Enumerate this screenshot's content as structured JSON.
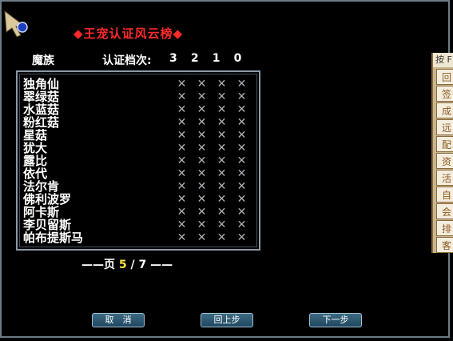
{
  "title": "◆王宠认证风云榜◆",
  "header": {
    "race": "魔族",
    "level_label": "认证档次:",
    "grades": [
      "3",
      "2",
      "1",
      "0"
    ]
  },
  "list": [
    {
      "name": "独角仙",
      "marks": [
        "✕",
        "✕",
        "✕",
        "✕"
      ]
    },
    {
      "name": "翠绿菇",
      "marks": [
        "✕",
        "✕",
        "✕",
        "✕"
      ]
    },
    {
      "name": "水蓝菇",
      "marks": [
        "✕",
        "✕",
        "✕",
        "✕"
      ]
    },
    {
      "name": "粉红菇",
      "marks": [
        "✕",
        "✕",
        "✕",
        "✕"
      ]
    },
    {
      "name": "星菇",
      "marks": [
        "✕",
        "✕",
        "✕",
        "✕"
      ]
    },
    {
      "name": "犹大",
      "marks": [
        "✕",
        "✕",
        "✕",
        "✕"
      ]
    },
    {
      "name": "露比",
      "marks": [
        "✕",
        "✕",
        "✕",
        "✕"
      ]
    },
    {
      "name": "依代",
      "marks": [
        "✕",
        "✕",
        "✕",
        "✕"
      ]
    },
    {
      "name": "法尔肯",
      "marks": [
        "✕",
        "✕",
        "✕",
        "✕"
      ]
    },
    {
      "name": "佛利波罗",
      "marks": [
        "✕",
        "✕",
        "✕",
        "✕"
      ]
    },
    {
      "name": "阿卡斯",
      "marks": [
        "✕",
        "✕",
        "✕",
        "✕"
      ]
    },
    {
      "name": "李贝留斯",
      "marks": [
        "✕",
        "✕",
        "✕",
        "✕"
      ]
    },
    {
      "name": "帕布提斯马",
      "marks": [
        "✕",
        "✕",
        "✕",
        "✕"
      ]
    }
  ],
  "pager": {
    "prefix": "——页",
    "current": "5",
    "sep": "/",
    "total": "7",
    "suffix": "——"
  },
  "buttons": {
    "cancel": "取　消",
    "prev": "回上步",
    "next": "下一步"
  },
  "side_panel": {
    "top": "按 F",
    "tabs": [
      "回",
      "签",
      "成",
      "远",
      "配",
      "资",
      "活",
      "自",
      "会",
      "排",
      "客"
    ]
  },
  "colors": {
    "title": "#ff2a2a",
    "current_page": "#ffe34a",
    "button": "#2e5a73"
  }
}
